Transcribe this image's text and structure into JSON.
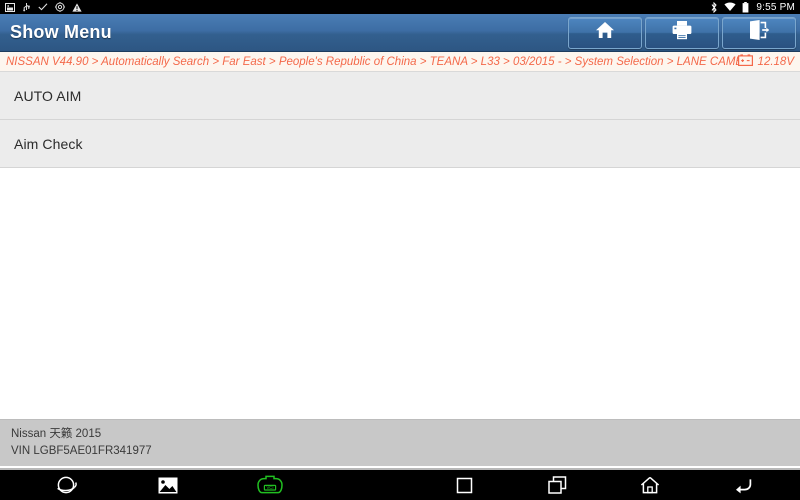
{
  "status_bar": {
    "icons_left": [
      "screenshot-icon",
      "usb-icon",
      "check-icon",
      "settings-gear-icon",
      "warning-icon"
    ],
    "icons_right": [
      "bluetooth-icon",
      "wifi-icon",
      "battery-icon"
    ],
    "clock": "9:55 PM"
  },
  "title_bar": {
    "title": "Show Menu",
    "buttons": [
      {
        "name": "home-button",
        "icon": "home-icon"
      },
      {
        "name": "print-button",
        "icon": "printer-icon"
      },
      {
        "name": "exit-button",
        "icon": "exit-door-icon"
      }
    ]
  },
  "breadcrumb": {
    "path": "NISSAN V44.90 > Automatically Search > Far East > People's Republic of China > TEANA > L33 > 03/2015 - > System Selection > LANE CAMERA",
    "voltage": "12.18V",
    "voltage_icon": "car-battery-icon",
    "text_color": "#f4694a",
    "background": "#fdf6ef"
  },
  "menu": {
    "items": [
      {
        "label": "AUTO AIM"
      },
      {
        "label": "Aim Check"
      }
    ]
  },
  "footer": {
    "vehicle": "Nissan 天籁 2015",
    "vin": "VIN LGBF5AE01FR341977"
  },
  "nav_bar": {
    "left_buttons": [
      {
        "name": "browser-icon"
      },
      {
        "name": "gallery-icon"
      },
      {
        "name": "vci-icon",
        "label": "VCI",
        "color": "#21c021"
      }
    ],
    "right_buttons": [
      {
        "name": "stop-square-icon"
      },
      {
        "name": "recent-apps-icon"
      },
      {
        "name": "android-home-icon"
      },
      {
        "name": "back-arrow-icon"
      }
    ]
  }
}
